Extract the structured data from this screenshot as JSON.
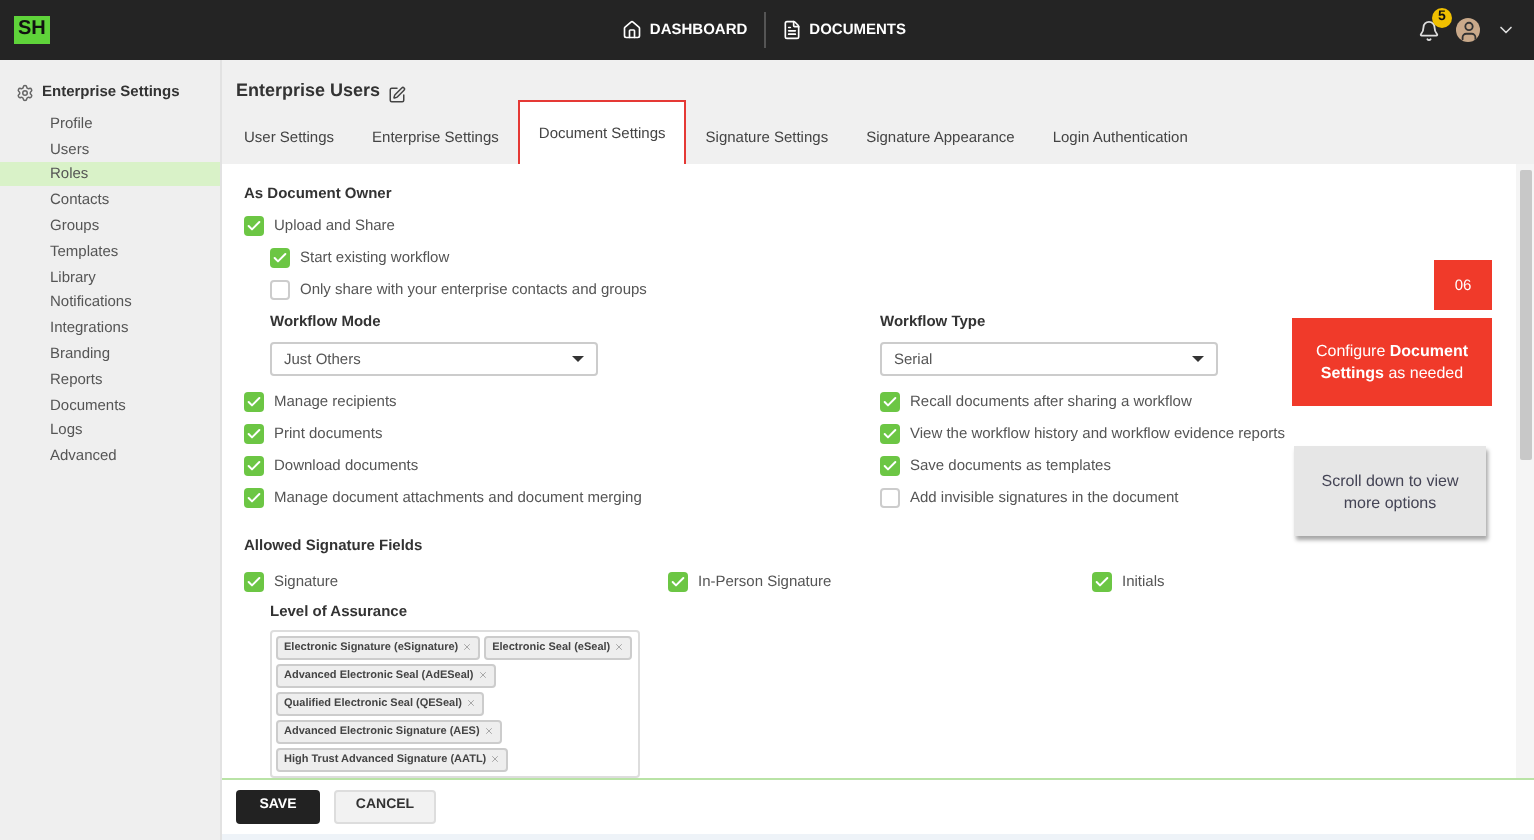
{
  "top_bar": {
    "logo": "SH",
    "nav": [
      {
        "label": "DASHBOARD",
        "kind": "home"
      },
      {
        "label": "DOCUMENTS",
        "kind": "document"
      }
    ],
    "notification_count": "5"
  },
  "sidebar": {
    "heading": "Enterprise Settings",
    "items": [
      {
        "label": "Profile",
        "selected": false
      },
      {
        "label": "Users",
        "selected": false
      },
      {
        "label": "Roles",
        "selected": true
      },
      {
        "label": "Contacts",
        "selected": false
      },
      {
        "label": "Groups",
        "selected": false
      },
      {
        "label": "Templates",
        "selected": false
      },
      {
        "label": "Library",
        "selected": false
      },
      {
        "label": "Notifications",
        "selected": false
      },
      {
        "label": "Integrations",
        "selected": false
      },
      {
        "label": "Branding",
        "selected": false
      },
      {
        "label": "Reports",
        "selected": false
      },
      {
        "label": "Documents",
        "selected": false
      },
      {
        "label": "Logs",
        "selected": false
      },
      {
        "label": "Advanced",
        "selected": false
      }
    ]
  },
  "page": {
    "title": "Enterprise Users",
    "tabs": [
      {
        "label": "User Settings",
        "selected": false
      },
      {
        "label": "Enterprise Settings",
        "selected": false
      },
      {
        "label": "Document Settings",
        "selected": true
      },
      {
        "label": "Signature Settings",
        "selected": false
      },
      {
        "label": "Signature Appearance",
        "selected": false
      },
      {
        "label": "Login Authentication",
        "selected": false
      }
    ]
  },
  "document_owner": {
    "heading": "As Document Owner",
    "upload": {
      "label": "Upload and Share",
      "checked": true
    },
    "sub_options": [
      {
        "label": "Start existing workflow",
        "checked": true
      },
      {
        "label": "Only share with your enterprise contacts and groups",
        "checked": false
      }
    ],
    "workflow_mode": {
      "label": "Workflow Mode",
      "value": "Just Others"
    },
    "workflow_type": {
      "label": "Workflow Type",
      "value": "Serial"
    },
    "left_options": [
      {
        "label": "Manage recipients",
        "checked": true
      },
      {
        "label": "Print documents",
        "checked": true
      },
      {
        "label": "Download documents",
        "checked": true
      },
      {
        "label": "Manage document attachments and document merging",
        "checked": true
      }
    ],
    "right_options": [
      {
        "label": "Recall documents after sharing a workflow",
        "checked": true
      },
      {
        "label": "View the workflow history and workflow evidence reports",
        "checked": true
      },
      {
        "label": "Save documents as templates",
        "checked": true
      },
      {
        "label": "Add invisible signatures in the document",
        "checked": false
      }
    ]
  },
  "signature_fields": {
    "heading": "Allowed Signature Fields",
    "fields": [
      {
        "label": "Signature",
        "checked": true
      },
      {
        "label": "In-Person Signature",
        "checked": true
      },
      {
        "label": "Initials",
        "checked": true
      }
    ],
    "assurance": {
      "label": "Level of Assurance",
      "tags": [
        "Electronic Signature (eSignature)",
        "Electronic Seal (eSeal)",
        "Advanced Electronic Seal (AdESeal)",
        "Qualified Electronic Seal (QESeal)",
        "Advanced Electronic Signature (AES)",
        "High Trust Advanced Signature (AATL)"
      ]
    }
  },
  "guide": {
    "step": "06",
    "message": "Configure **Document Settings** as needed",
    "hint": "Scroll down to view more options"
  },
  "footer": {
    "buttons": [
      {
        "label": "SAVE",
        "kind": "primary"
      },
      {
        "label": "CANCEL",
        "kind": "secondary"
      }
    ]
  }
}
